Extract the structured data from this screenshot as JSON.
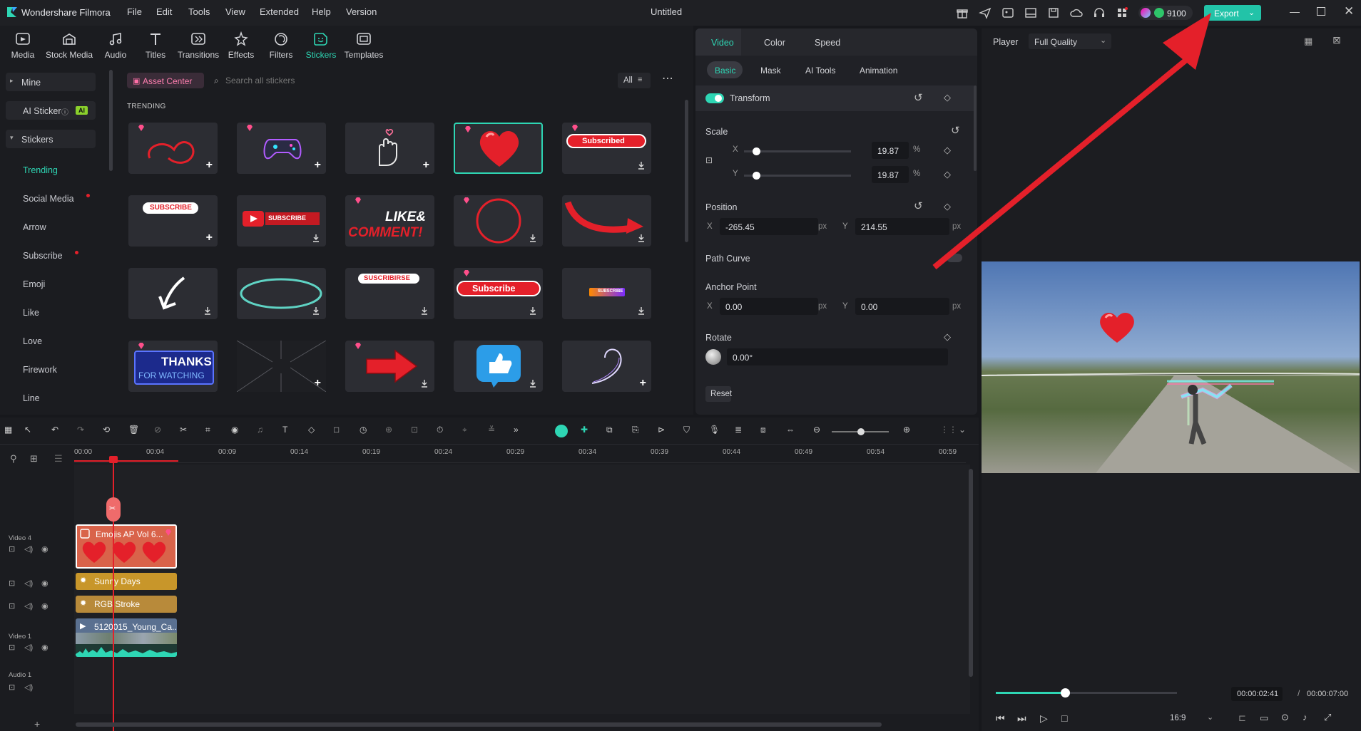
{
  "titlebar": {
    "app": "Wondershare Filmora",
    "menu": [
      "File",
      "Edit",
      "Tools",
      "View",
      "Extended",
      "Help",
      "Version"
    ],
    "project": "Untitled",
    "credits": "9100",
    "export": "Export"
  },
  "toptools": [
    {
      "label": "Media",
      "icon": "media-icon"
    },
    {
      "label": "Stock Media",
      "icon": "stock-media-icon"
    },
    {
      "label": "Audio",
      "icon": "audio-icon"
    },
    {
      "label": "Titles",
      "icon": "titles-icon"
    },
    {
      "label": "Transitions",
      "icon": "transitions-icon"
    },
    {
      "label": "Effects",
      "icon": "effects-icon"
    },
    {
      "label": "Filters",
      "icon": "filters-icon"
    },
    {
      "label": "Stickers",
      "icon": "stickers-icon",
      "active": true
    },
    {
      "label": "Templates",
      "icon": "templates-icon"
    }
  ],
  "categories": {
    "mine": "Mine",
    "ai_sticker": "AI Sticker",
    "ai_badge": "AI",
    "stickers": "Stickers",
    "items": [
      "Trending",
      "Social Media",
      "Arrow",
      "Subscribe",
      "Emoji",
      "Like",
      "Love",
      "Firework",
      "Line"
    ]
  },
  "grid": {
    "asset_center": "Asset Center",
    "search_placeholder": "Search all stickers",
    "filter": "All",
    "section": "TRENDING",
    "tiles_text": {
      "subscribed": "Subscribed",
      "subscribe_caps": "SUBSCRIBE",
      "subscribe_small": "SUBSCRIBE",
      "like1": "LIKE&",
      "like2": "COMMENT!",
      "suscribirse": "SUSCRIBIRSE",
      "subscribe_btn": "Subscribe",
      "thanks1": "THANKS",
      "thanks2": "FOR WATCHING",
      "sub_mini": "SUBSCRIBE"
    }
  },
  "props": {
    "tabs": [
      "Video",
      "Color",
      "Speed"
    ],
    "subtabs": [
      "Basic",
      "Mask",
      "AI Tools",
      "Animation"
    ],
    "transform": "Transform",
    "scale": "Scale",
    "x": "X",
    "y": "Y",
    "scale_x": "19.87",
    "scale_y": "19.87",
    "pct": "%",
    "position": "Position",
    "pos_x": "-265.45",
    "pos_y": "214.55",
    "px": "px",
    "path_curve": "Path Curve",
    "anchor": "Anchor Point",
    "anc_x": "0.00",
    "anc_y": "0.00",
    "rotate": "Rotate",
    "rot_val": "0.00°",
    "reset": "Reset"
  },
  "player": {
    "label": "Player",
    "quality": "Full Quality",
    "current": "00:00:02:41",
    "sep": "/",
    "total": "00:00:07:00",
    "ratio": "16:9",
    "progress": 0.38
  },
  "timeline": {
    "ticks": [
      "00:00",
      "00:04",
      "00:09",
      "00:14",
      "00:19",
      "00:24",
      "00:29",
      "00:34",
      "00:39",
      "00:44",
      "00:49",
      "00:54",
      "00:59"
    ],
    "tracks": {
      "v4": "Video 4",
      "v1": "Video 1",
      "a1": "Audio 1"
    },
    "clips": {
      "emojis": "Emojis AP Vol 6...",
      "sunny": "Sunny Days",
      "rgb": "RGB Stroke",
      "video": "5120015_Young_Ca..."
    }
  },
  "colors": {
    "accent": "#2ed6b4",
    "export": "#22c3a8",
    "red": "#e4202a",
    "gem": "#ff4f8b"
  }
}
